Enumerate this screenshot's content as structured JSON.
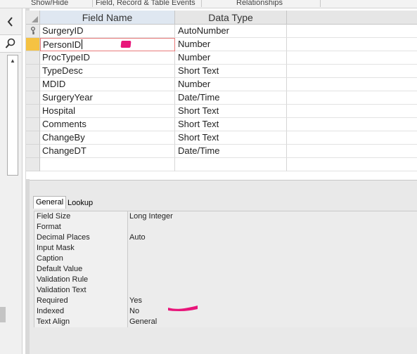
{
  "ribbon": {
    "groups": [
      "Show/Hide",
      "Field, Record & Table Events",
      "Relationships"
    ]
  },
  "nav": {
    "collapse_icon": "chevron-left-icon",
    "search_icon": "search-icon"
  },
  "grid": {
    "headers": {
      "field_name": "Field Name",
      "data_type": "Data Type",
      "description": ""
    },
    "rows": [
      {
        "name": "SurgeryID",
        "type": "AutoNumber",
        "key": true
      },
      {
        "name": "PersonID",
        "type": "Number",
        "active": true
      },
      {
        "name": "ProcTypeID",
        "type": "Number"
      },
      {
        "name": "TypeDesc",
        "type": "Short Text"
      },
      {
        "name": "MDID",
        "type": "Number"
      },
      {
        "name": "SurgeryYear",
        "type": "Date/Time"
      },
      {
        "name": "Hospital",
        "type": "Short Text"
      },
      {
        "name": "Comments",
        "type": "Short Text"
      },
      {
        "name": "ChangeBy",
        "type": "Short Text"
      },
      {
        "name": "ChangeDT",
        "type": "Date/Time"
      },
      {
        "name": "",
        "type": ""
      }
    ]
  },
  "properties": {
    "tabs": [
      "General",
      "Lookup"
    ],
    "active_tab": "General",
    "rows": [
      {
        "name": "Field Size",
        "value": "Long Integer"
      },
      {
        "name": "Format",
        "value": ""
      },
      {
        "name": "Decimal Places",
        "value": "Auto"
      },
      {
        "name": "Input Mask",
        "value": ""
      },
      {
        "name": "Caption",
        "value": ""
      },
      {
        "name": "Default Value",
        "value": ""
      },
      {
        "name": "Validation Rule",
        "value": ""
      },
      {
        "name": "Validation Text",
        "value": ""
      },
      {
        "name": "Required",
        "value": "Yes"
      },
      {
        "name": "Indexed",
        "value": "No"
      },
      {
        "name": "Text Align",
        "value": "General"
      }
    ]
  },
  "colors": {
    "annotation": "#e8157a",
    "active_row_selector": "#f5c242",
    "active_cell_border": "#e87a7a"
  }
}
